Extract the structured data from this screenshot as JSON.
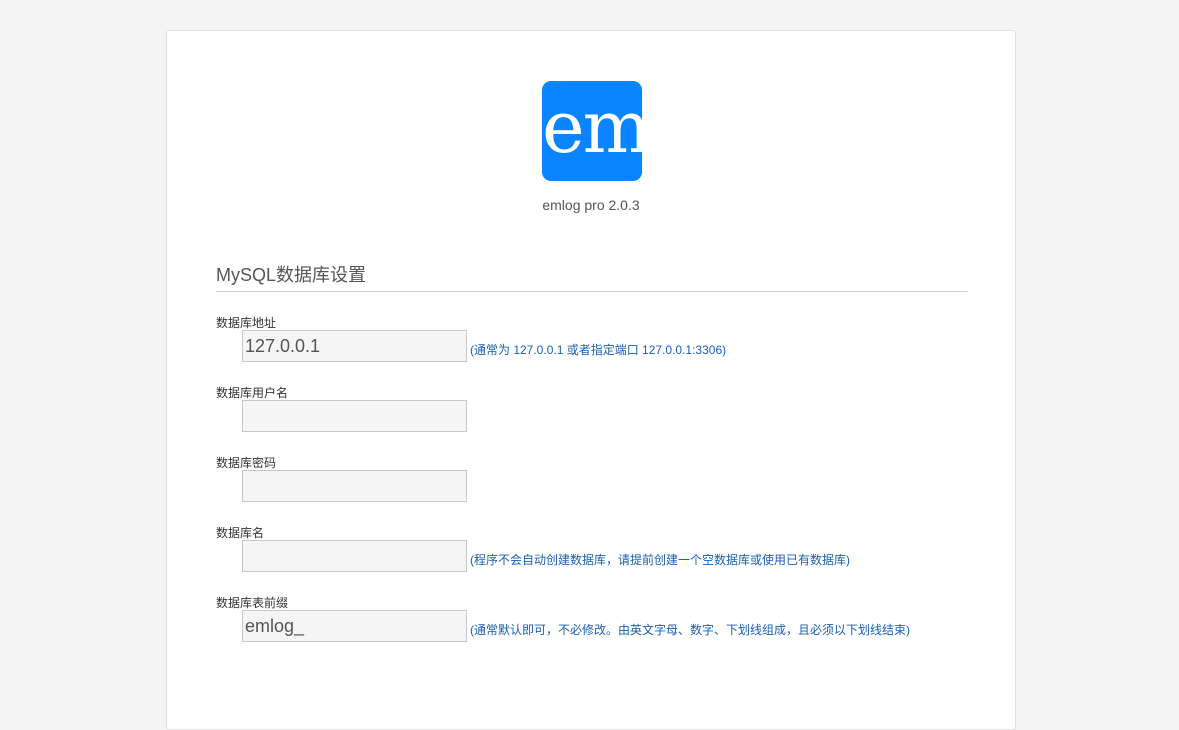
{
  "app": {
    "logo_text": "em",
    "version": "emlog pro 2.0.3",
    "brand_color": "#0a85ff"
  },
  "section": {
    "title": "MySQL数据库设置"
  },
  "fields": {
    "db_host": {
      "label": "数据库地址",
      "value": "127.0.0.1",
      "hint": "(通常为 127.0.0.1 或者指定端口 127.0.0.1:3306)"
    },
    "db_user": {
      "label": "数据库用户名",
      "value": ""
    },
    "db_password": {
      "label": "数据库密码",
      "value": ""
    },
    "db_name": {
      "label": "数据库名",
      "value": "",
      "hint": "(程序不会自动创建数据库，请提前创建一个空数据库或使用已有数据库)"
    },
    "db_prefix": {
      "label": "数据库表前缀",
      "value": "emlog_",
      "hint": "(通常默认即可，不必修改。由英文字母、数字、下划线组成，且必须以下划线结束)"
    }
  },
  "colors": {
    "hint_text": "#1a5fb4",
    "input_background": "#f5f5f5",
    "page_background": "#f4f4f4"
  }
}
